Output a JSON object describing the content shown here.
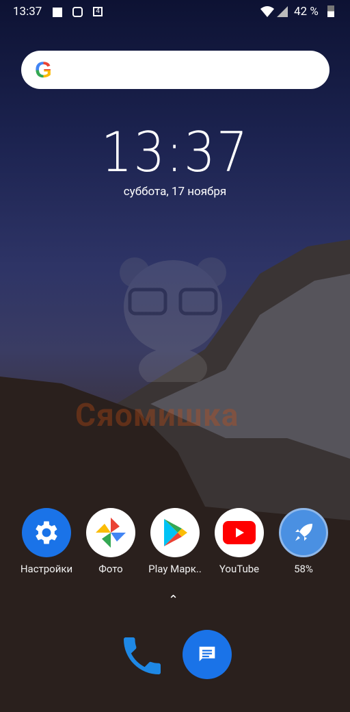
{
  "status_bar": {
    "time": "13:37",
    "battery": "42 %",
    "icons": [
      "gallery-icon",
      "instagram-icon",
      "notification-4-icon",
      "wifi-icon",
      "signal-no-sim-icon",
      "battery-charging-icon"
    ]
  },
  "search": {
    "logo": "G"
  },
  "clock": {
    "time": "13:37",
    "date": "суббота, 17 ноября"
  },
  "watermark": "Сяомишка",
  "apps": [
    {
      "label": "Настройки",
      "icon": "settings-icon",
      "color": "#1a73e8"
    },
    {
      "label": "Фото",
      "icon": "google-photos-icon"
    },
    {
      "label": "Play Марк..",
      "icon": "play-store-icon"
    },
    {
      "label": "YouTube",
      "icon": "youtube-icon",
      "color": "#ff0000"
    },
    {
      "label": "58%",
      "icon": "rocket-booster-icon",
      "color": "#4a90e2",
      "progress": 58
    }
  ],
  "dock": [
    {
      "icon": "phone-icon"
    },
    {
      "icon": "messages-icon"
    }
  ]
}
